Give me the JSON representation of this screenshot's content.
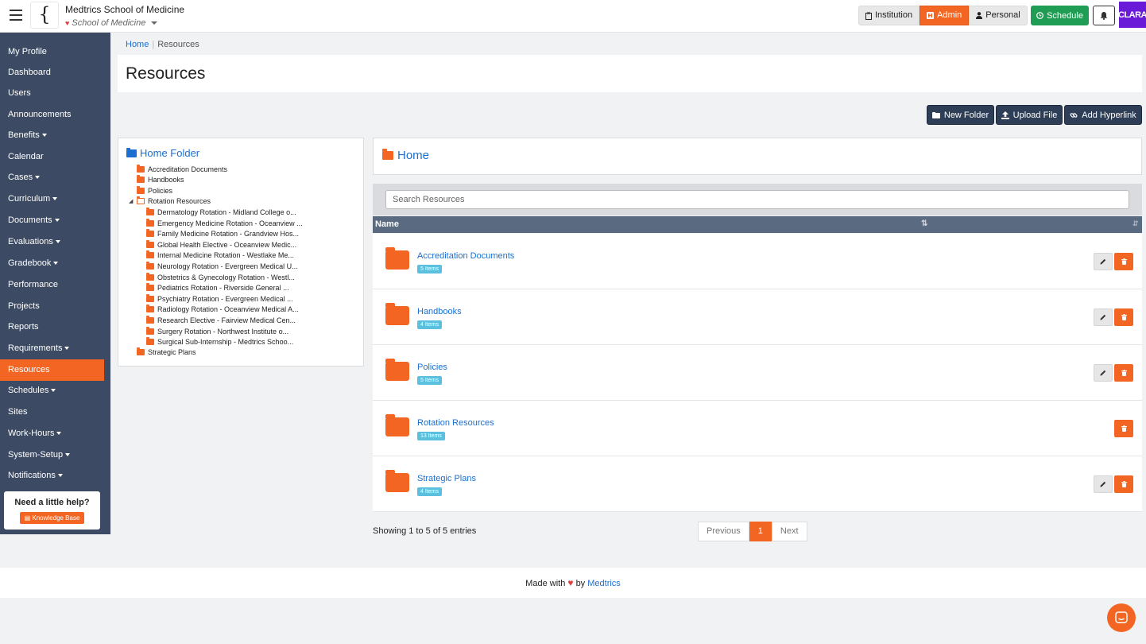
{
  "org": {
    "name": "Medtrics School of Medicine",
    "sub": "School of Medicine",
    "logo": "{ m"
  },
  "roles": {
    "institution": "Institution",
    "admin": "Admin",
    "personal": "Personal"
  },
  "header": {
    "schedule": "Schedule",
    "avatar": "CLARA"
  },
  "sidebar": {
    "items": [
      {
        "label": "My Profile",
        "caret": false
      },
      {
        "label": "Dashboard",
        "caret": false
      },
      {
        "label": "Users",
        "caret": false
      },
      {
        "label": "Announcements",
        "caret": false
      },
      {
        "label": "Benefits",
        "caret": true
      },
      {
        "label": "Calendar",
        "caret": false
      },
      {
        "label": "Cases",
        "caret": true
      },
      {
        "label": "Curriculum",
        "caret": true
      },
      {
        "label": "Documents",
        "caret": true
      },
      {
        "label": "Evaluations",
        "caret": true
      },
      {
        "label": "Gradebook",
        "caret": true
      },
      {
        "label": "Performance",
        "caret": false
      },
      {
        "label": "Projects",
        "caret": false
      },
      {
        "label": "Reports",
        "caret": false
      },
      {
        "label": "Requirements",
        "caret": true
      },
      {
        "label": "Resources",
        "caret": false
      },
      {
        "label": "Schedules",
        "caret": true
      },
      {
        "label": "Sites",
        "caret": false
      },
      {
        "label": "Work-Hours",
        "caret": true
      },
      {
        "label": "System-Setup",
        "caret": true
      },
      {
        "label": "Notifications",
        "caret": true
      }
    ],
    "active": "Resources",
    "help_title": "Need a little help?",
    "kb_label": "Knowledge Base"
  },
  "breadcrumb": {
    "home": "Home",
    "current": "Resources"
  },
  "page_title": "Resources",
  "actions": {
    "new_folder": "New Folder",
    "upload_file": "Upload File",
    "add_hyperlink": "Add Hyperlink"
  },
  "tree": {
    "root": "Home Folder",
    "top": [
      "Accreditation Documents",
      "Handbooks",
      "Policies",
      "Rotation Resources",
      "Strategic Plans"
    ],
    "rotation_children": [
      "Dermatology Rotation - Midland College o...",
      "Emergency Medicine Rotation - Oceanview ...",
      "Family Medicine Rotation - Grandview Hos...",
      "Global Health Elective - Oceanview Medic...",
      "Internal Medicine Rotation - Westlake Me...",
      "Neurology Rotation - Evergreen Medical U...",
      "Obstetrics & Gynecology Rotation - Westl...",
      "Pediatrics Rotation - Riverside General ...",
      "Psychiatry Rotation - Evergreen Medical ...",
      "Radiology Rotation - Oceanview Medical A...",
      "Research Elective - Fairview Medical Cen...",
      "Surgery Rotation - Northwest Institute o...",
      "Surgical Sub-Internship - Medtrics Schoo..."
    ]
  },
  "main": {
    "folder_title": "Home",
    "search_placeholder": "Search Resources",
    "column_name": "Name",
    "rows": [
      {
        "name": "Accreditation Documents",
        "count": "5 Items",
        "editable": true
      },
      {
        "name": "Handbooks",
        "count": "4 Items",
        "editable": true
      },
      {
        "name": "Policies",
        "count": "5 Items",
        "editable": true
      },
      {
        "name": "Rotation Resources",
        "count": "13 Items",
        "editable": false
      },
      {
        "name": "Strategic Plans",
        "count": "4 Items",
        "editable": true
      }
    ],
    "showing": "Showing 1 to 5 of 5 entries",
    "pager": {
      "prev": "Previous",
      "page": "1",
      "next": "Next"
    }
  },
  "footer": {
    "made_with": "Made with",
    "by": "by",
    "brand": "Medtrics"
  },
  "colors": {
    "accent": "#f26522",
    "sidebar": "#3c4b63",
    "link": "#1a6fd1",
    "success": "#1f9d55",
    "badge": "#5bc0de"
  }
}
